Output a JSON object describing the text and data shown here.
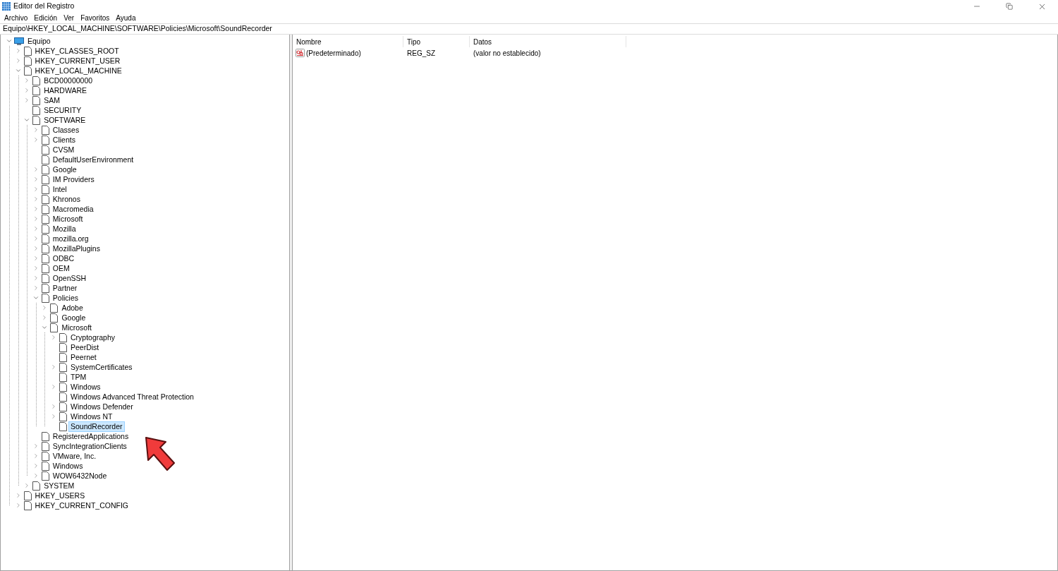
{
  "window": {
    "title": "Editor del Registro"
  },
  "menu": [
    "Archivo",
    "Edición",
    "Ver",
    "Favoritos",
    "Ayuda"
  ],
  "address": "Equipo\\HKEY_LOCAL_MACHINE\\SOFTWARE\\Policies\\Microsoft\\SoundRecorder",
  "tree": [
    {
      "label": "Equipo",
      "kind": "computer",
      "expanded": true,
      "selected": false,
      "children": [
        {
          "label": "HKEY_CLASSES_ROOT",
          "expanded": false,
          "selected": false
        },
        {
          "label": "HKEY_CURRENT_USER",
          "expanded": false,
          "selected": false
        },
        {
          "label": "HKEY_LOCAL_MACHINE",
          "expanded": true,
          "selected": false,
          "children": [
            {
              "label": "BCD00000000",
              "expanded": false,
              "selected": false
            },
            {
              "label": "HARDWARE",
              "expanded": false,
              "selected": false
            },
            {
              "label": "SAM",
              "expanded": false,
              "selected": false
            },
            {
              "label": "SECURITY",
              "selected": false
            },
            {
              "label": "SOFTWARE",
              "expanded": true,
              "selected": false,
              "children": [
                {
                  "label": "Classes",
                  "expanded": false,
                  "selected": false
                },
                {
                  "label": "Clients",
                  "expanded": false,
                  "selected": false
                },
                {
                  "label": "CVSM",
                  "selected": false
                },
                {
                  "label": "DefaultUserEnvironment",
                  "selected": false
                },
                {
                  "label": "Google",
                  "expanded": false,
                  "selected": false
                },
                {
                  "label": "IM Providers",
                  "expanded": false,
                  "selected": false
                },
                {
                  "label": "Intel",
                  "expanded": false,
                  "selected": false
                },
                {
                  "label": "Khronos",
                  "expanded": false,
                  "selected": false
                },
                {
                  "label": "Macromedia",
                  "expanded": false,
                  "selected": false
                },
                {
                  "label": "Microsoft",
                  "expanded": false,
                  "selected": false
                },
                {
                  "label": "Mozilla",
                  "expanded": false,
                  "selected": false
                },
                {
                  "label": "mozilla.org",
                  "expanded": false,
                  "selected": false
                },
                {
                  "label": "MozillaPlugins",
                  "expanded": false,
                  "selected": false
                },
                {
                  "label": "ODBC",
                  "expanded": false,
                  "selected": false
                },
                {
                  "label": "OEM",
                  "expanded": false,
                  "selected": false
                },
                {
                  "label": "OpenSSH",
                  "expanded": false,
                  "selected": false
                },
                {
                  "label": "Partner",
                  "expanded": false,
                  "selected": false
                },
                {
                  "label": "Policies",
                  "expanded": true,
                  "selected": false,
                  "children": [
                    {
                      "label": "Adobe",
                      "expanded": false,
                      "selected": false
                    },
                    {
                      "label": "Google",
                      "expanded": false,
                      "selected": false
                    },
                    {
                      "label": "Microsoft",
                      "expanded": true,
                      "selected": false,
                      "children": [
                        {
                          "label": "Cryptography",
                          "expanded": false,
                          "selected": false
                        },
                        {
                          "label": "PeerDist",
                          "selected": false
                        },
                        {
                          "label": "Peernet",
                          "selected": false
                        },
                        {
                          "label": "SystemCertificates",
                          "expanded": false,
                          "selected": false
                        },
                        {
                          "label": "TPM",
                          "selected": false
                        },
                        {
                          "label": "Windows",
                          "expanded": false,
                          "selected": false
                        },
                        {
                          "label": "Windows Advanced Threat Protection",
                          "selected": false
                        },
                        {
                          "label": "Windows Defender",
                          "expanded": false,
                          "selected": false
                        },
                        {
                          "label": "Windows NT",
                          "expanded": false,
                          "selected": false
                        },
                        {
                          "label": "SoundRecorder",
                          "selected": true
                        }
                      ]
                    }
                  ]
                },
                {
                  "label": "RegisteredApplications",
                  "selected": false
                },
                {
                  "label": "SyncIntegrationClients",
                  "expanded": false,
                  "selected": false
                },
                {
                  "label": "VMware, Inc.",
                  "expanded": false,
                  "selected": false
                },
                {
                  "label": "Windows",
                  "expanded": false,
                  "selected": false
                },
                {
                  "label": "WOW6432Node",
                  "expanded": false,
                  "selected": false
                }
              ]
            },
            {
              "label": "SYSTEM",
              "expanded": false,
              "selected": false
            }
          ]
        },
        {
          "label": "HKEY_USERS",
          "expanded": false,
          "selected": false
        },
        {
          "label": "HKEY_CURRENT_CONFIG",
          "expanded": false,
          "selected": false
        }
      ]
    }
  ],
  "values": {
    "columns": [
      "Nombre",
      "Tipo",
      "Datos"
    ],
    "rows": [
      {
        "kind": "string",
        "name": "(Predeterminado)",
        "type": "REG_SZ",
        "data": "(valor no establecido)"
      }
    ]
  }
}
